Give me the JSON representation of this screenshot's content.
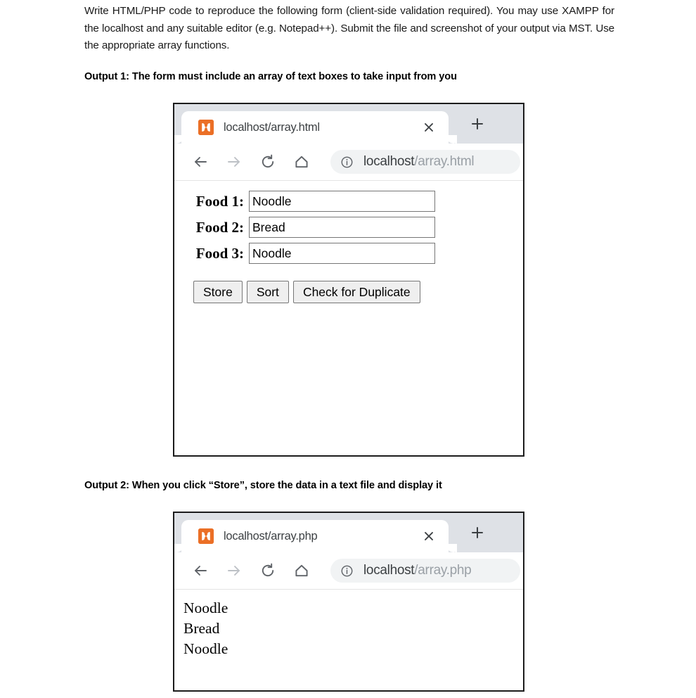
{
  "question": {
    "text": "Write HTML/PHP code to reproduce the following form (client-side validation required). You may use XAMPP for the localhost and any suitable editor (e.g. Notepad++). Submit the file and screenshot of your output via MST. Use the appropriate array functions."
  },
  "sections": [
    {
      "heading": "Output 1: The form must include an array of text boxes to take input from you",
      "browser": {
        "tab_title": "localhost/array.html",
        "favicon_name": "xampp-favicon",
        "favicon_color": "#eb6f26",
        "close_label": "×",
        "new_tab_label": "+",
        "nav": {
          "back": "back-arrow",
          "forward": "forward-arrow",
          "reload": "reload-icon",
          "home": "home-icon",
          "info": "info-icon"
        },
        "address": {
          "host": "localhost",
          "path": "/array.html"
        }
      },
      "form": {
        "fields": [
          {
            "label": "Food 1:",
            "value": "Noodle"
          },
          {
            "label": "Food 2:",
            "value": "Bread"
          },
          {
            "label": "Food 3:",
            "value": "Noodle"
          }
        ],
        "buttons": [
          "Store",
          "Sort",
          "Check for Duplicate"
        ]
      }
    },
    {
      "heading": "Output 2: When you click “Store”, store the data in a text file and display it",
      "browser": {
        "tab_title": "localhost/array.php",
        "favicon_name": "xampp-favicon",
        "favicon_color": "#eb6f26",
        "close_label": "×",
        "new_tab_label": "+",
        "nav": {
          "back": "back-arrow",
          "forward": "forward-arrow",
          "reload": "reload-icon",
          "home": "home-icon",
          "info": "info-icon"
        },
        "address": {
          "host": "localhost",
          "path": "/array.php"
        }
      },
      "output_lines": [
        "Noodle",
        "Bread",
        "Noodle"
      ]
    }
  ]
}
